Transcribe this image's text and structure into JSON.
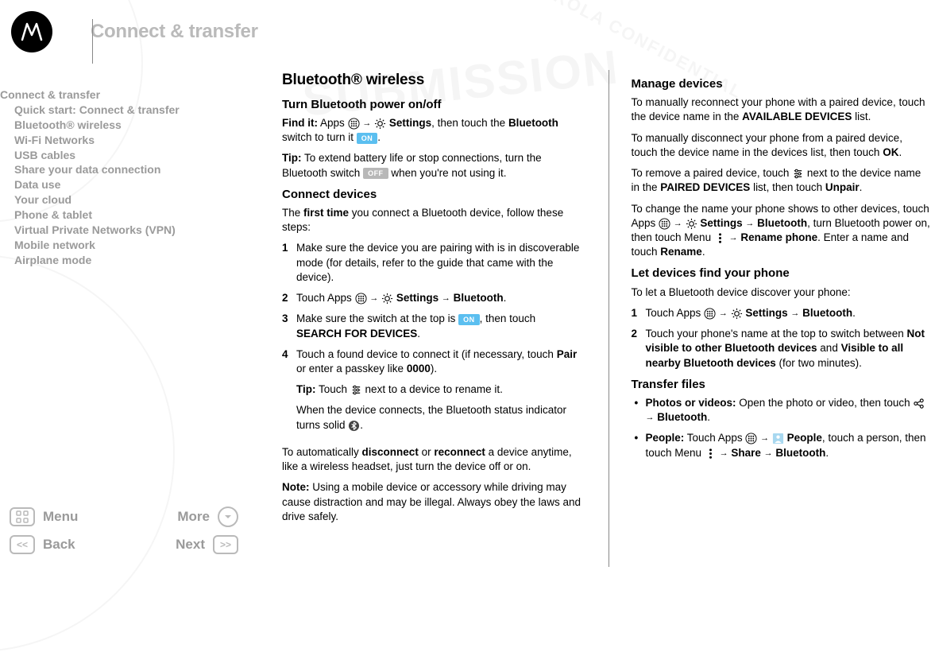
{
  "header": {
    "title": "Connect & transfer"
  },
  "toc": {
    "root": "Connect & transfer",
    "items": [
      "Quick start: Connect & transfer",
      "Bluetooth® wireless",
      "Wi-Fi Networks",
      "USB cables",
      "Share your data connection",
      "Data use",
      "Your cloud",
      "Phone & tablet",
      "Virtual Private Networks (VPN)",
      "Mobile network",
      "Airplane mode"
    ]
  },
  "nav": {
    "menu": "Menu",
    "more": "More",
    "back": "Back",
    "next": "Next"
  },
  "badges": {
    "on": "ON",
    "off": "OFF"
  },
  "col1": {
    "h2": "Bluetooth® wireless",
    "h3a": "Turn Bluetooth power on/off",
    "p1a": "Find it:",
    "p1b": "Apps",
    "p1c": "Settings",
    "p1d": ", then touch the ",
    "p1e": "Bluetooth",
    "p1f": " switch to turn it ",
    "p2a": "Tip:",
    "p2b": " To extend battery life or stop connections, turn the Bluetooth switch ",
    "p2c": " when you're not using it.",
    "h3b": "Connect devices",
    "p3a": "The ",
    "p3b": "first time",
    "p3c": " you connect a Bluetooth device, follow these steps:",
    "li1": "Make sure the device you are pairing with is in discoverable mode (for details, refer to the guide that came with the device).",
    "li2a": "Touch Apps ",
    "li2b": "Settings",
    "li2c": "Bluetooth",
    "li3a": "Make sure the switch at the top is ",
    "li3b": ", then touch ",
    "li3c": "SEARCH FOR DEVICES",
    "li4a": "Touch a found device to connect it (if necessary, touch ",
    "li4b": "Pair",
    "li4c": " or enter a passkey like ",
    "li4d": "0000",
    "li4e": ").",
    "li4tipA": "Tip:",
    "li4tipB": " Touch ",
    "li4tipC": " next to a device to rename it.",
    "li4w": "When the device connects, the Bluetooth status indicator turns solid ",
    "p4a": "To automatically ",
    "p4b": "disconnect",
    "p4c": " or ",
    "p4d": "reconnect",
    "p4e": " a device anytime, like a wireless headset, just turn the device off or on.",
    "p5a": "Note:",
    "p5b": " Using a mobile device or accessory while driving may cause distraction and may be illegal. Always obey the laws and drive safely."
  },
  "col2": {
    "h3a": "Manage devices",
    "p1a": "To manually reconnect your phone with a paired device, touch the device name in the ",
    "p1b": "AVAILABLE DEVICES",
    "p1c": " list.",
    "p2a": "To manually disconnect your phone from a paired device, touch the device name in the devices list, then touch ",
    "p2b": "OK",
    "p3a": "To remove a paired device, touch ",
    "p3b": " next to the device name in the ",
    "p3c": "PAIRED DEVICES",
    "p3d": " list, then touch ",
    "p3e": "Unpair",
    "p4a": "To change the name your phone shows to other devices, touch Apps ",
    "p4b": "Settings",
    "p4c": "Bluetooth",
    "p4d": ", turn Bluetooth power on, then touch Menu ",
    "p4e": "Rename phone",
    "p4f": ". Enter a name and touch ",
    "p4g": "Rename",
    "h3b": "Let devices find your phone",
    "p5": "To let a Bluetooth device discover your phone:",
    "li1a": "Touch Apps ",
    "li1b": "Settings",
    "li1c": "Bluetooth",
    "li2a": "Touch your phone's name at the top to switch between ",
    "li2b": "Not visible to other Bluetooth devices",
    "li2c": " and ",
    "li2d": "Visible to all nearby Bluetooth devices",
    "li2e": " (for two minutes).",
    "h3c": "Transfer files",
    "b1a": "Photos or videos:",
    "b1b": " Open the photo or video, then touch ",
    "b1c": "Bluetooth",
    "b2a": "People:",
    "b2b": " Touch Apps ",
    "b2c": "People",
    "b2d": ", touch a person, then touch Menu ",
    "b2e": "Share",
    "b2f": "Bluetooth"
  }
}
